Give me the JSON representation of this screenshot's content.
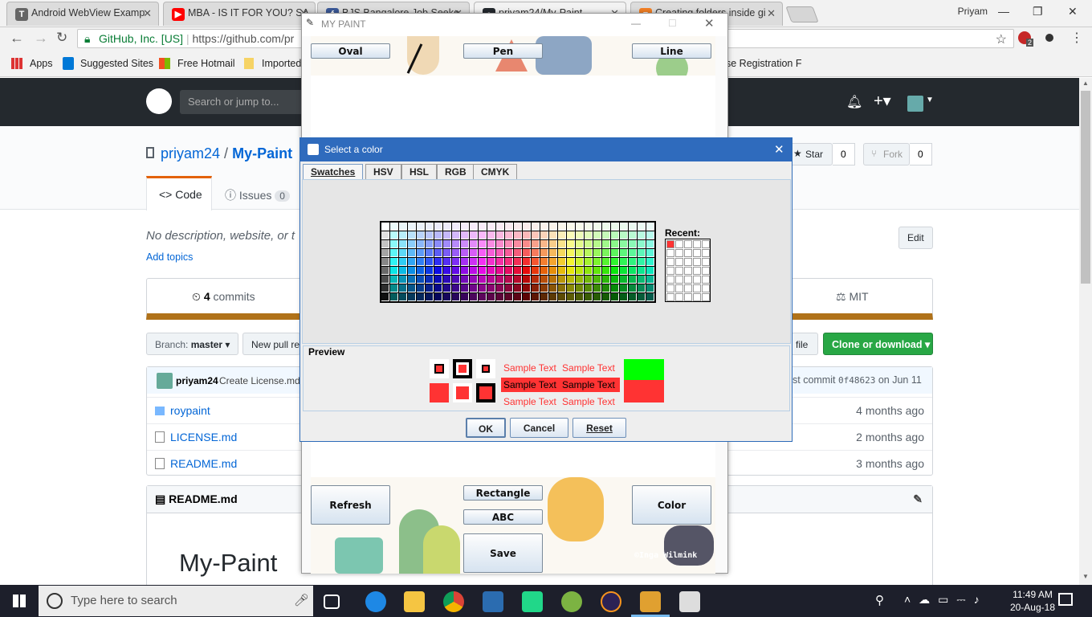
{
  "browser": {
    "tabs": [
      {
        "label": "Android WebView Examp",
        "icon": "letter-t-icon",
        "icon_char": "T",
        "color": "#666666"
      },
      {
        "label": "MBA - IS IT FOR YOU? SA",
        "icon": "youtube-icon",
        "icon_char": "▶",
        "color": "#ff0000"
      },
      {
        "label": "BJS Bangalore Job Seeke",
        "icon": "facebook-icon",
        "icon_char": "f",
        "color": "#3b5998"
      },
      {
        "label": "priyam24/My-Paint",
        "icon": "github-icon",
        "icon_char": "●",
        "color": "#24292e"
      },
      {
        "label": "Creating folders inside gi",
        "icon": "stackoverflow-icon",
        "icon_char": "≡",
        "color": "#f48024"
      }
    ],
    "profile": "Priyam",
    "address": {
      "site_name": "GitHub, Inc. [US]",
      "url": "https://github.com/pr"
    },
    "badge": "2",
    "bookmarks": [
      "Apps",
      "Suggested Sites",
      "Free Hotmail",
      "Imported",
      "se Registration F"
    ]
  },
  "github": {
    "search_placeholder": "Search or jump to...",
    "owner": "priyam24",
    "repo": "My-Paint",
    "sep": "/",
    "star_label": "Star",
    "star_count": "0",
    "fork_label": "Fork",
    "fork_count": "0",
    "tabs": [
      {
        "label": "Code"
      },
      {
        "label": "Issues",
        "count": "0"
      }
    ],
    "description": "No description, website, or t",
    "add_topics": "Add topics",
    "edit_label": "Edit",
    "commits_count": "4",
    "commits_label": "commits",
    "license": "MIT",
    "branch_label": "Branch:",
    "branch": "master",
    "new_pr": "New pull re",
    "file_label": "file",
    "clone_label": "Clone or download",
    "commit_user": "priyam24",
    "commit_msg": "Create License.md",
    "latest_commit_prefix": "st commit",
    "latest_commit_hash": "0f48623",
    "latest_commit_date": "on Jun 11",
    "files": [
      {
        "name": "roypaint",
        "age": "4 months ago",
        "type": "folder"
      },
      {
        "name": "LICENSE.md",
        "age": "2 months ago",
        "type": "file"
      },
      {
        "name": "README.md",
        "age": "3 months ago",
        "type": "file"
      }
    ],
    "readme_header": "README.md",
    "readme_title": "My-Paint"
  },
  "paint": {
    "title": "MY PAINT",
    "top_buttons": [
      "Oval",
      "Pen",
      "Line"
    ],
    "bottom_buttons": {
      "refresh": "Refresh",
      "rectangle": "Rectangle",
      "abc": "ABC",
      "save": "Save",
      "color": "Color"
    },
    "watermark": "©Inga Wilmink"
  },
  "color_dialog": {
    "title": "Select a color",
    "tabs": [
      "Swatches",
      "HSV",
      "HSL",
      "RGB",
      "CMYK"
    ],
    "active_tab": "Swatches",
    "recent_label": "Recent:",
    "recent_color": "#ff3333",
    "preview_label": "Preview",
    "sample_text": "Sample Text",
    "selected_color": "#ff3333",
    "previous_color": "#00ff00",
    "buttons": {
      "ok": "OK",
      "cancel": "Cancel",
      "reset": "Reset"
    }
  },
  "taskbar": {
    "search_placeholder": "Type here to search",
    "time": "11:49 AM",
    "date": "20-Aug-18"
  }
}
